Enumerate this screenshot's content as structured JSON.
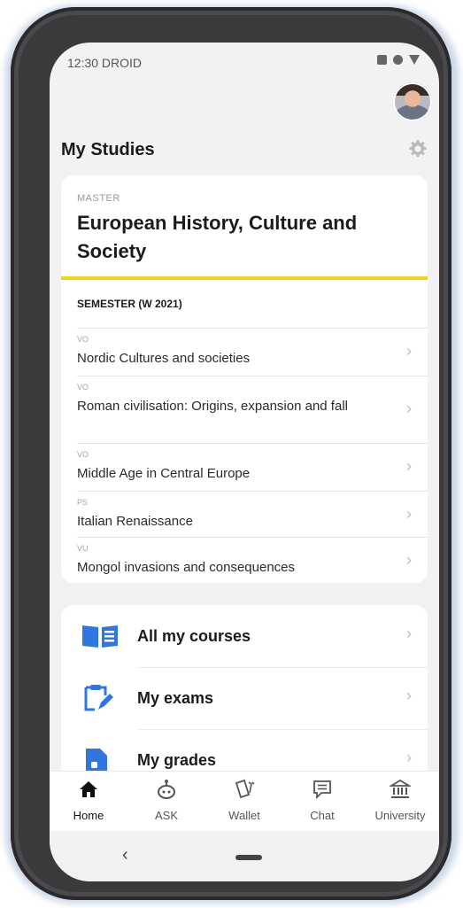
{
  "status_bar": {
    "time": "12:30 DROID"
  },
  "header": {
    "title": "My Studies"
  },
  "degree": {
    "kind": "MASTER",
    "title": "European History, Culture and Society",
    "accent_color": "#f2d21c",
    "semester": "SEMESTER (W 2021)",
    "courses": [
      {
        "type": "VO",
        "name": "Nordic Cultures and societies"
      },
      {
        "type": "VO",
        "name": "Roman civilisation: Origins, expansion and fall"
      },
      {
        "type": "VO",
        "name": "Middle Age in Central Europe"
      },
      {
        "type": "PS",
        "name": "Italian Renaissance"
      },
      {
        "type": "VU",
        "name": "Mongol invasions and consequences"
      }
    ]
  },
  "menu": [
    {
      "label": "All my courses",
      "icon": "book-icon"
    },
    {
      "label": "My exams",
      "icon": "clipboard-edit-icon"
    },
    {
      "label": "My grades",
      "icon": "document-icon"
    }
  ],
  "tabs": [
    {
      "label": "Home",
      "icon": "home-icon",
      "active": true
    },
    {
      "label": "ASK",
      "icon": "robot-icon"
    },
    {
      "label": "Wallet",
      "icon": "cards-icon"
    },
    {
      "label": "Chat",
      "icon": "chat-icon"
    },
    {
      "label": "University",
      "icon": "bank-icon"
    }
  ],
  "colors": {
    "icon_blue": "#2f76e0",
    "accent": "#f2d21c"
  }
}
